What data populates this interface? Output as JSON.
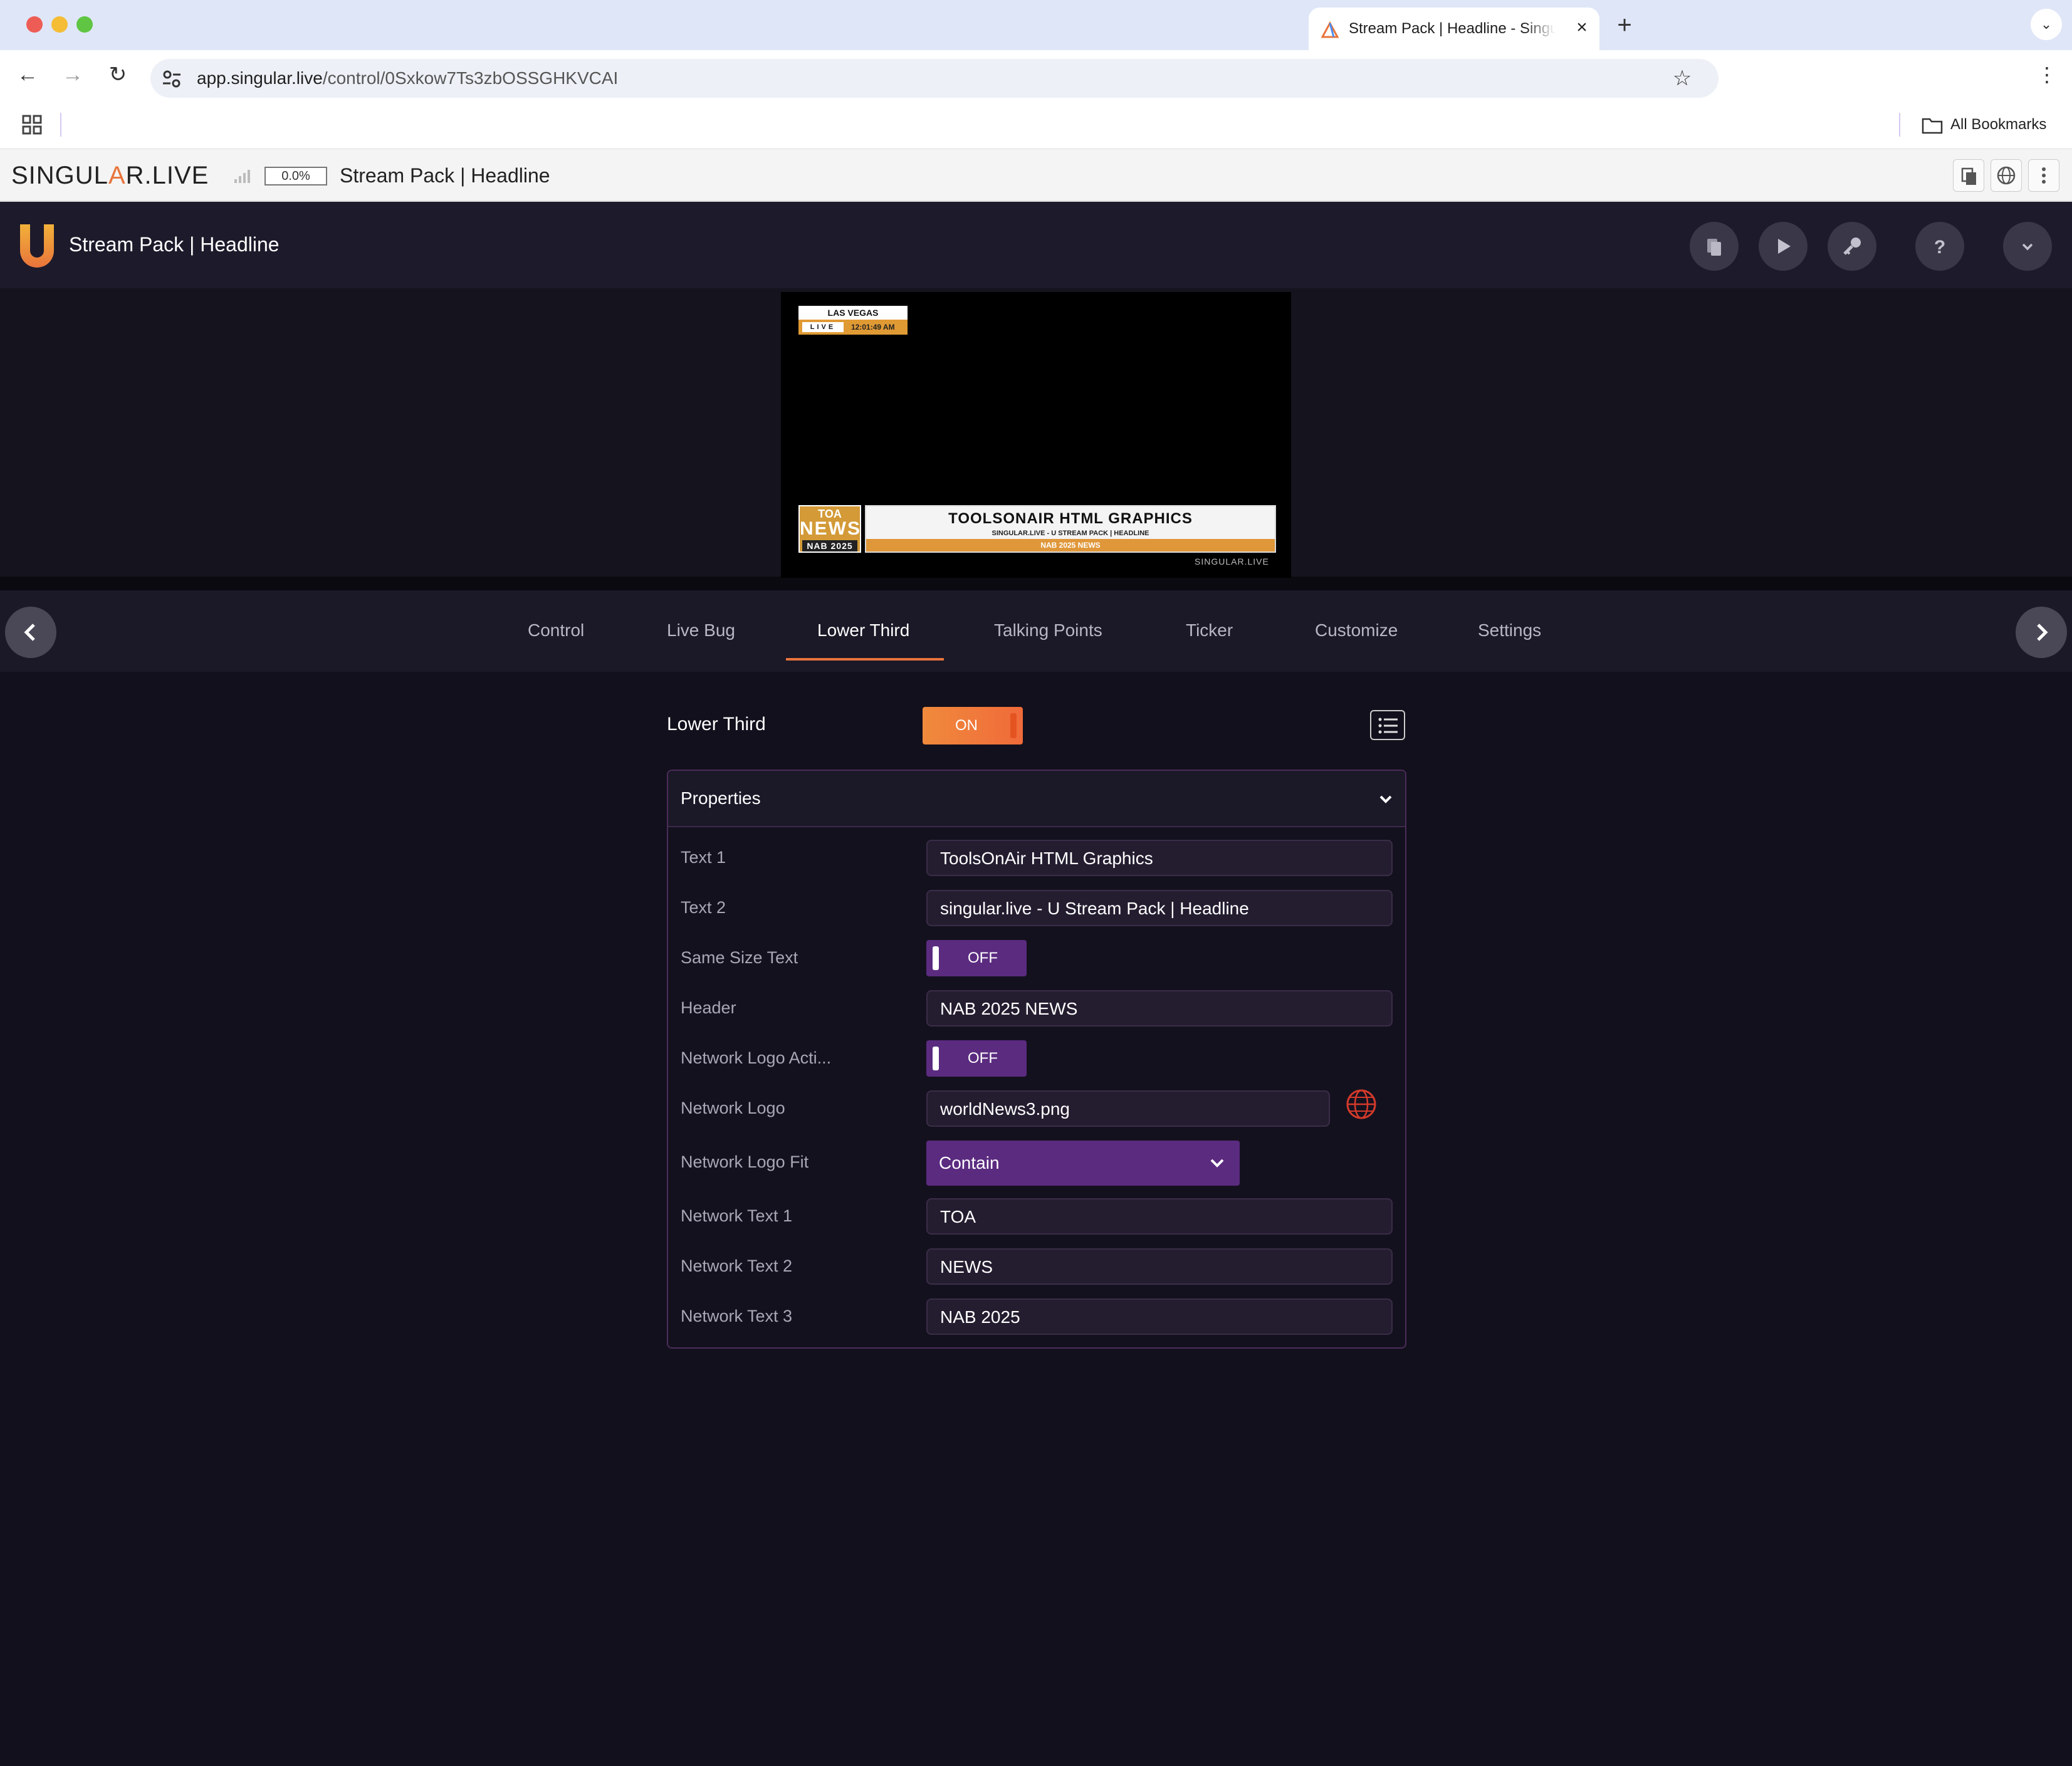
{
  "browser": {
    "tab_title": "Stream Pack | Headline - Singular.live",
    "url_host": "app.singular.live",
    "url_path": "/control/0Sxkow7Ts3zbOSSGHKVCAI",
    "all_bookmarks_label": "All Bookmarks"
  },
  "singular_bar": {
    "brand_prefix": "SINGUL",
    "brand_accent": "A",
    "brand_suffix": "R.LIVE",
    "progress_label": "0.0%",
    "title": "Stream Pack | Headline"
  },
  "app_header": {
    "title": "Stream Pack | Headline",
    "buttons": [
      "copy-icon",
      "play-icon",
      "key-icon",
      "help-icon",
      "chevron-down-icon"
    ]
  },
  "preview": {
    "bug_city": "LAS VEGAS",
    "bug_live": "LIVE",
    "bug_time": "12:01:49 AM",
    "net_text_1": "TOA",
    "net_text_2": "NEWS",
    "net_text_3": "NAB 2025",
    "lt_text_1": "TOOLSONAIR HTML GRAPHICS",
    "lt_text_2": "SINGULAR.LIVE - U STREAM PACK | HEADLINE",
    "lt_header": "NAB 2025 NEWS",
    "brand": "SINGULAR.LIVE"
  },
  "tabs": [
    {
      "label": "Control",
      "active": false
    },
    {
      "label": "Live Bug",
      "active": false
    },
    {
      "label": "Lower Third",
      "active": true
    },
    {
      "label": "Talking Points",
      "active": false
    },
    {
      "label": "Ticker",
      "active": false
    },
    {
      "label": "Customize",
      "active": false
    },
    {
      "label": "Settings",
      "active": false
    }
  ],
  "section": {
    "label": "Lower Third",
    "toggle_label": "ON",
    "panel_title": "Properties",
    "rows": {
      "text1": {
        "label": "Text 1",
        "value": "ToolsOnAir HTML Graphics"
      },
      "text2": {
        "label": "Text 2",
        "value": "singular.live - U Stream Pack | Headline"
      },
      "same_size": {
        "label": "Same Size Text",
        "value": "OFF"
      },
      "header": {
        "label": "Header",
        "value": "NAB 2025 NEWS"
      },
      "net_logo_active": {
        "label": "Network Logo Acti...",
        "value": "OFF"
      },
      "net_logo": {
        "label": "Network Logo",
        "value": "worldNews3.png"
      },
      "net_logo_fit": {
        "label": "Network Logo Fit",
        "value": "Contain"
      },
      "net_text1": {
        "label": "Network Text 1",
        "value": "TOA"
      },
      "net_text2": {
        "label": "Network Text 2",
        "value": "NEWS"
      },
      "net_text3": {
        "label": "Network Text 3",
        "value": "NAB 2025"
      }
    }
  },
  "colors": {
    "accent": "#e8743b",
    "purple": "#5b2b80",
    "background": "#12101c"
  }
}
